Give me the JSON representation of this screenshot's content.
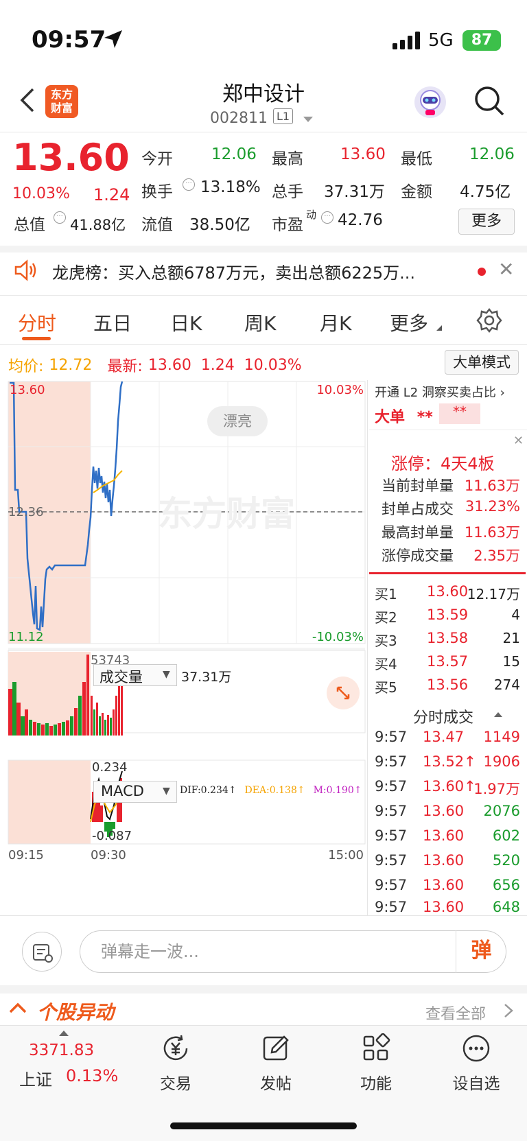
{
  "status_bar": {
    "time": "09:57",
    "network": "5G",
    "battery": "87"
  },
  "nav": {
    "title": "郑中设计",
    "code": "002811",
    "level": "L1",
    "logo_line1": "东方",
    "logo_line2": "财富"
  },
  "quote": {
    "price": "13.60",
    "pct": "10.03%",
    "change": "1.24",
    "open_lbl": "今开",
    "open": "12.06",
    "high_lbl": "最高",
    "high": "13.60",
    "low_lbl": "最低",
    "low": "12.06",
    "turnover_lbl": "换手",
    "turnover": "13.18%",
    "volume_lbl": "总手",
    "volume": "37.31万",
    "amount_lbl": "金额",
    "amount": "4.75亿",
    "total_mv_lbl": "总值",
    "total_mv": "41.88亿",
    "float_mv_lbl": "流值",
    "float_mv": "38.50亿",
    "pe_lbl": "市盈",
    "pe_sup": "动",
    "pe": "42.76",
    "more": "更多"
  },
  "dragon_tiger": {
    "text": "龙虎榜：买入总额6787万元，卖出总额6225万..."
  },
  "tabs": [
    "分时",
    "五日",
    "日K",
    "周K",
    "月K",
    "更多"
  ],
  "avg_row": {
    "avg_lbl": "均价:",
    "avg": "12.72",
    "latest_lbl": "最新:",
    "latest": "13.60",
    "chg": "1.24",
    "pct": "10.03%",
    "big_order_btn": "大单模式"
  },
  "chart": {
    "y_top": "13.60",
    "y_mid": "12.36",
    "y_bot": "11.12",
    "pct_top": "10.03%",
    "pct_bot": "-10.03%",
    "watermark": "东方财富",
    "pretty_btn": "漂亮",
    "vol_selector": "成交量",
    "vol_total": "37.31万",
    "vol_max": "53743",
    "macd_selector": "MACD",
    "dif": "DIF:0.234↑",
    "dea": "DEA:0.138↑",
    "m": "M:0.190↑",
    "macd_top": "0.234",
    "macd_bot": "-0.087",
    "t_start": "09:15",
    "t_open": "09:30",
    "t_end": "15:00",
    "colors": {
      "price_line": "#2f6fc6",
      "avg_line": "#f5b400",
      "up": "#e8232e",
      "down": "#1a9c2d",
      "auction_bg": "#fbe0d6"
    }
  },
  "right_panel": {
    "l2_text": "开通 L2 洞察买卖占比",
    "big_order_lbl": "大单",
    "big_order_stars1": "**",
    "big_order_stars2": "**",
    "limit_title": "涨停：4天4板",
    "limit_rows": [
      {
        "label": "当前封单量",
        "value": "11.63万"
      },
      {
        "label": "封单占成交",
        "value": "31.23%"
      },
      {
        "label": "最高封单量",
        "value": "11.63万"
      },
      {
        "label": "涨停成交量",
        "value": "2.35万"
      }
    ],
    "orderbook": [
      {
        "label": "买1",
        "price": "13.60",
        "vol": "12.17万"
      },
      {
        "label": "买2",
        "price": "13.59",
        "vol": "4"
      },
      {
        "label": "买3",
        "price": "13.58",
        "vol": "21"
      },
      {
        "label": "买4",
        "price": "13.57",
        "vol": "15"
      },
      {
        "label": "买5",
        "price": "13.56",
        "vol": "274"
      }
    ],
    "ticks_title": "分时成交",
    "ticks": [
      {
        "t": "9:57",
        "p": "13.47",
        "v": "1149",
        "c": "red"
      },
      {
        "t": "9:57",
        "p": "13.52↑",
        "v": "1906",
        "c": "red"
      },
      {
        "t": "9:57",
        "p": "13.60↑",
        "v": "1.97万",
        "c": "red"
      },
      {
        "t": "9:57",
        "p": "13.60",
        "v": "2076",
        "c": "green"
      },
      {
        "t": "9:57",
        "p": "13.60",
        "v": "602",
        "c": "green"
      },
      {
        "t": "9:57",
        "p": "13.60",
        "v": "520",
        "c": "green"
      },
      {
        "t": "9:57",
        "p": "13.60",
        "v": "656",
        "c": "green"
      },
      {
        "t": "9:57",
        "p": "13.60",
        "v": "648",
        "c": "green"
      }
    ]
  },
  "bottom": {
    "barrage_placeholder": "弹幕走一波...",
    "barrage_send": "弹",
    "alert_title": "个股异动",
    "view_all": "查看全部",
    "index_val": "3371.83",
    "index_name": "上证",
    "index_pct": "0.13%",
    "tabbar": [
      {
        "icon": "yuan-exchange-icon",
        "label": "交易"
      },
      {
        "icon": "edit-post-icon",
        "label": "发帖"
      },
      {
        "icon": "grid-function-icon",
        "label": "功能"
      },
      {
        "icon": "dots-more-icon",
        "label": "设自选"
      }
    ]
  }
}
